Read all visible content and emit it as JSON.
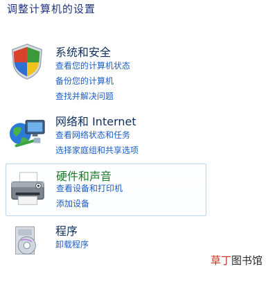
{
  "page": {
    "title": "调整计算机的设置"
  },
  "categories": [
    {
      "title": "系统和安全",
      "icon": "shield-icon",
      "links": [
        "查看您的计算机状态",
        "备份您的计算机",
        "查找并解决问题"
      ]
    },
    {
      "title": "网络和 Internet",
      "icon": "network-globe-icon",
      "links": [
        "查看网络状态和任务",
        "选择家庭组和共享选项"
      ]
    },
    {
      "title": "硬件和声音",
      "icon": "printer-icon",
      "links": [
        "查看设备和打印机",
        "添加设备"
      ]
    },
    {
      "title": "程序",
      "icon": "programs-disc-icon",
      "links": [
        "卸载程序"
      ]
    }
  ],
  "watermark": {
    "part1": "草丁",
    "part2": "图书馆"
  },
  "colors": {
    "link": "#1d5ec7",
    "title": "#0d2e5c",
    "hover_title": "#1c7a2a",
    "page_title": "#1e3287"
  }
}
